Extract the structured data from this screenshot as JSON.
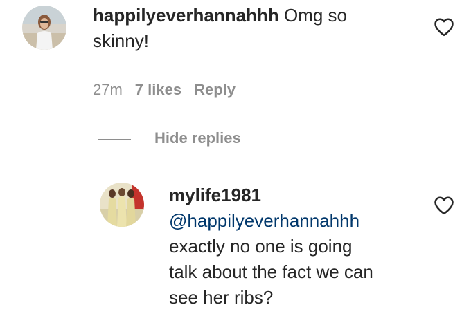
{
  "comment": {
    "username": "happilyeverhannahhh",
    "text_line1": "Omg so",
    "text_line2": "skinny!",
    "time": "27m",
    "likes": "7 likes",
    "reply_label": "Reply"
  },
  "hide_replies_label": "Hide replies",
  "reply": {
    "username": "mylife1981",
    "mention": "@happilyeverhannahhh",
    "text_lines": [
      "exactly no one is going",
      "talk about the fact we can",
      "see her ribs?"
    ]
  },
  "colors": {
    "text": "#262626",
    "secondary": "#8e8e8e",
    "mention": "#00376b"
  },
  "icons": {
    "like": "heart-outline-icon"
  }
}
